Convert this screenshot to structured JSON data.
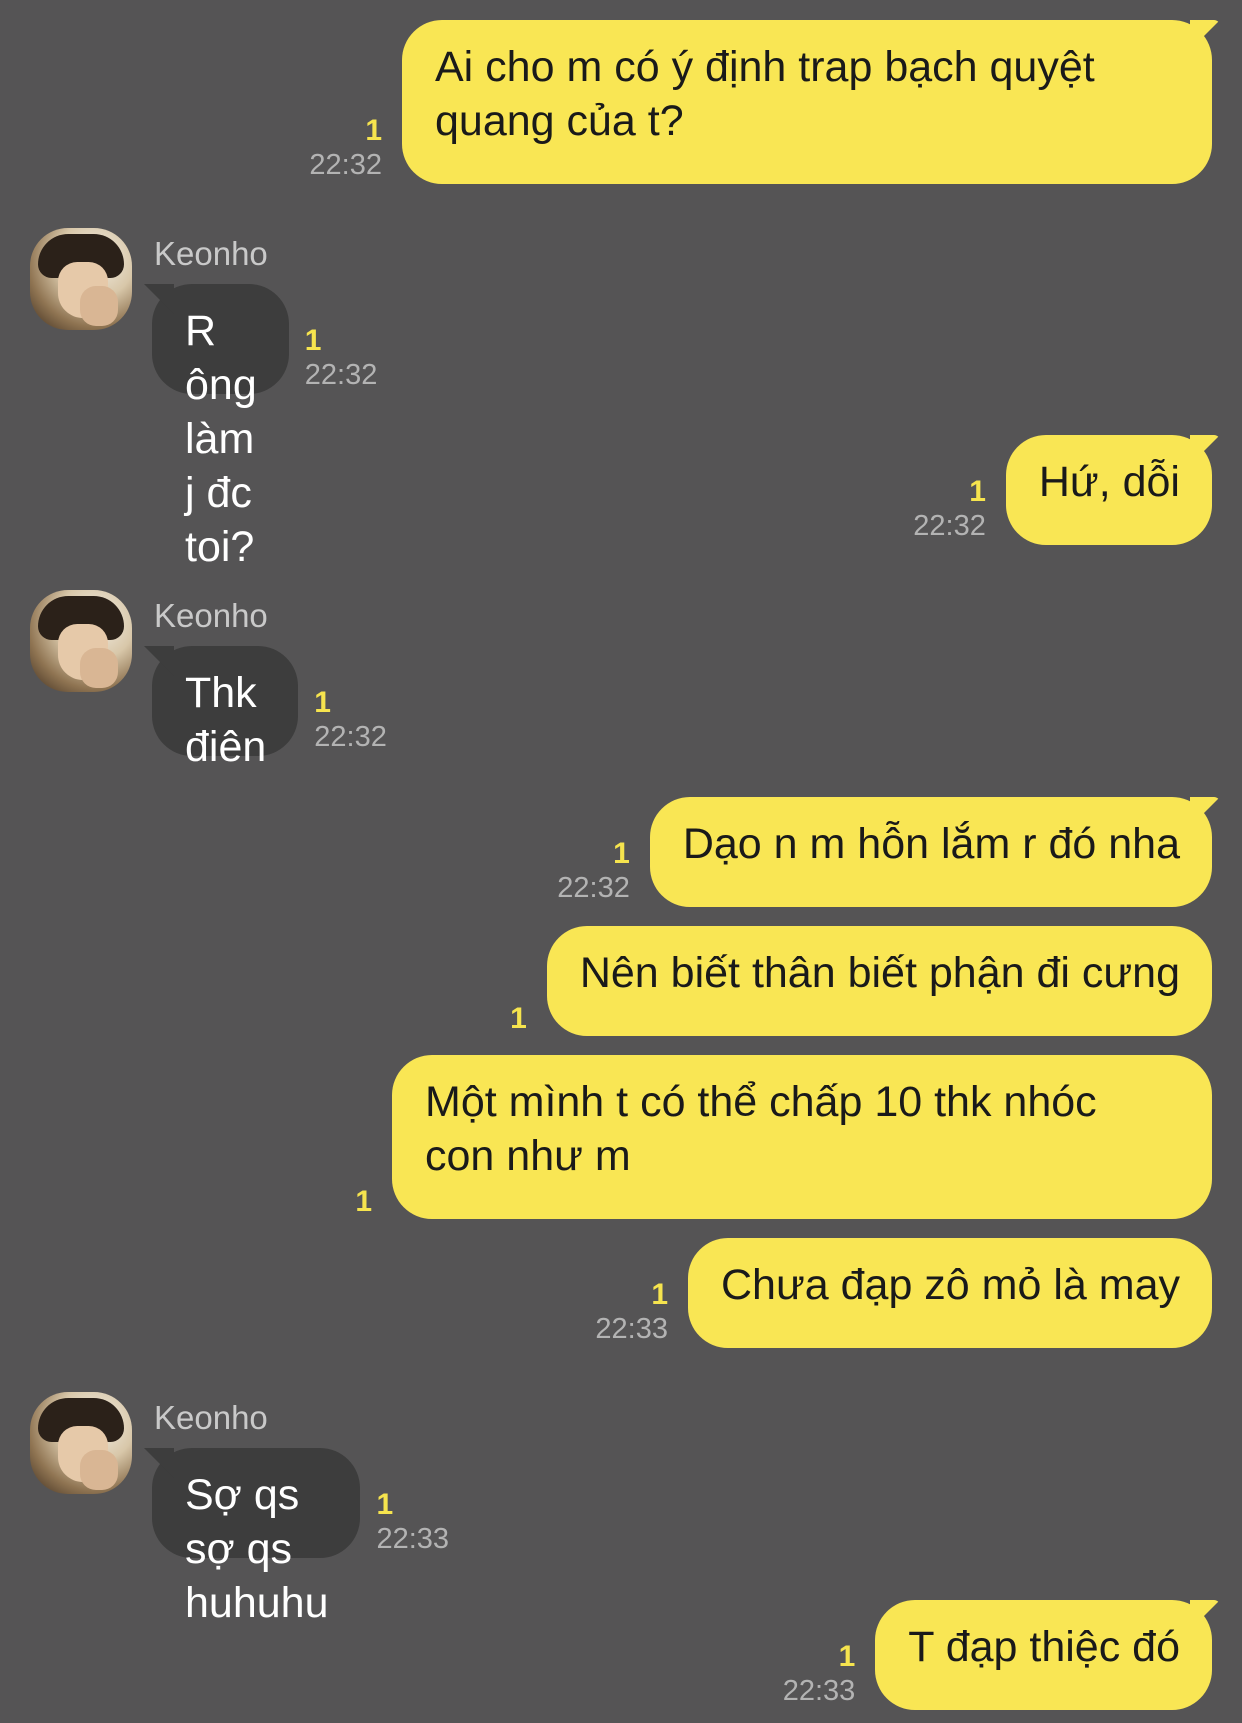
{
  "contact": {
    "name": "Keonho",
    "avatar_icon": "profile-photo"
  },
  "messages": [
    {
      "from": "me",
      "text": "Ai cho m có ý định trap bạch quyệt\nquang của t?",
      "read": "1",
      "time": "22:32"
    },
    {
      "from": "Keonho",
      "text": "R ông làm j đc toi?",
      "read": "1",
      "time": "22:32"
    },
    {
      "from": "me",
      "text": "Hứ, dỗi",
      "read": "1",
      "time": "22:32"
    },
    {
      "from": "Keonho",
      "text": "Thk điên",
      "read": "1",
      "time": "22:32"
    },
    {
      "from": "me",
      "text": "Dạo n m hỗn lắm r đó nha",
      "read": "1",
      "time": "22:32"
    },
    {
      "from": "me",
      "text": "Nên biết thân biết phận đi cưng",
      "read": "1",
      "time": ""
    },
    {
      "from": "me",
      "text": "Một mình t có thể chấp 10 thk nhóc\ncon như m",
      "read": "1",
      "time": ""
    },
    {
      "from": "me",
      "text": "Chưa đạp zô mỏ là may",
      "read": "1",
      "time": "22:33"
    },
    {
      "from": "Keonho",
      "text": "Sợ qs sợ qs huhuhu",
      "read": "1",
      "time": "22:33"
    },
    {
      "from": "me",
      "text": "T đạp thiệc đó",
      "read": "1",
      "time": "22:33"
    }
  ],
  "colors": {
    "background": "#555455",
    "outgoing_bubble": "#f9e654",
    "incoming_bubble": "#3d3d3d",
    "read_count": "#f6e44e",
    "timestamp": "#b3b3b3"
  }
}
